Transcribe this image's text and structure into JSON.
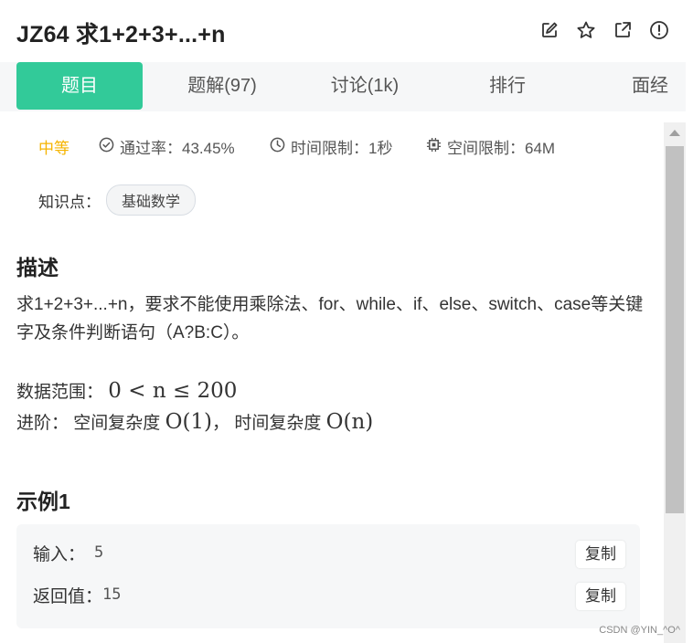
{
  "header": {
    "title": "JZ64  求1+2+3+...+n",
    "icons": [
      "edit-icon",
      "star-icon",
      "share-icon",
      "report-icon"
    ]
  },
  "tabs": [
    {
      "label": "题目",
      "active": true
    },
    {
      "label": "题解(97)",
      "active": false
    },
    {
      "label": "讨论(1k)",
      "active": false
    },
    {
      "label": "排行",
      "active": false
    },
    {
      "label": "面经",
      "active": false
    }
  ],
  "meta": {
    "difficulty": "中等",
    "pass_rate": "通过率：43.45%",
    "time_limit": "时间限制：1秒",
    "space_limit": "空间限制：64M"
  },
  "knowledge": {
    "label": "知识点：",
    "tag": "基础数学"
  },
  "description": {
    "title": "描述",
    "text": "求1+2+3+...+n，要求不能使用乘除法、for、while、if、else、switch、case等关键字及条件判断语句（A?B:C）。",
    "range_label": "数据范围：",
    "range_math": "0 < n ≤ 200",
    "advanced_label": "进阶：",
    "advanced_space_label": "空间复杂度",
    "advanced_space_value": "O(1)",
    "advanced_sep": "，",
    "advanced_time_label": "时间复杂度",
    "advanced_time_value": "O(n)"
  },
  "example": {
    "title": "示例1",
    "input_label": "输入：",
    "input_value": "5",
    "output_label": "返回值：",
    "output_value": "15",
    "copy_label": "复制"
  },
  "watermark": "CSDN @YIN_^O^",
  "colors": {
    "accent": "#32ca99",
    "difficulty": "#f5b400",
    "tab_bg": "#f6f7f8"
  }
}
